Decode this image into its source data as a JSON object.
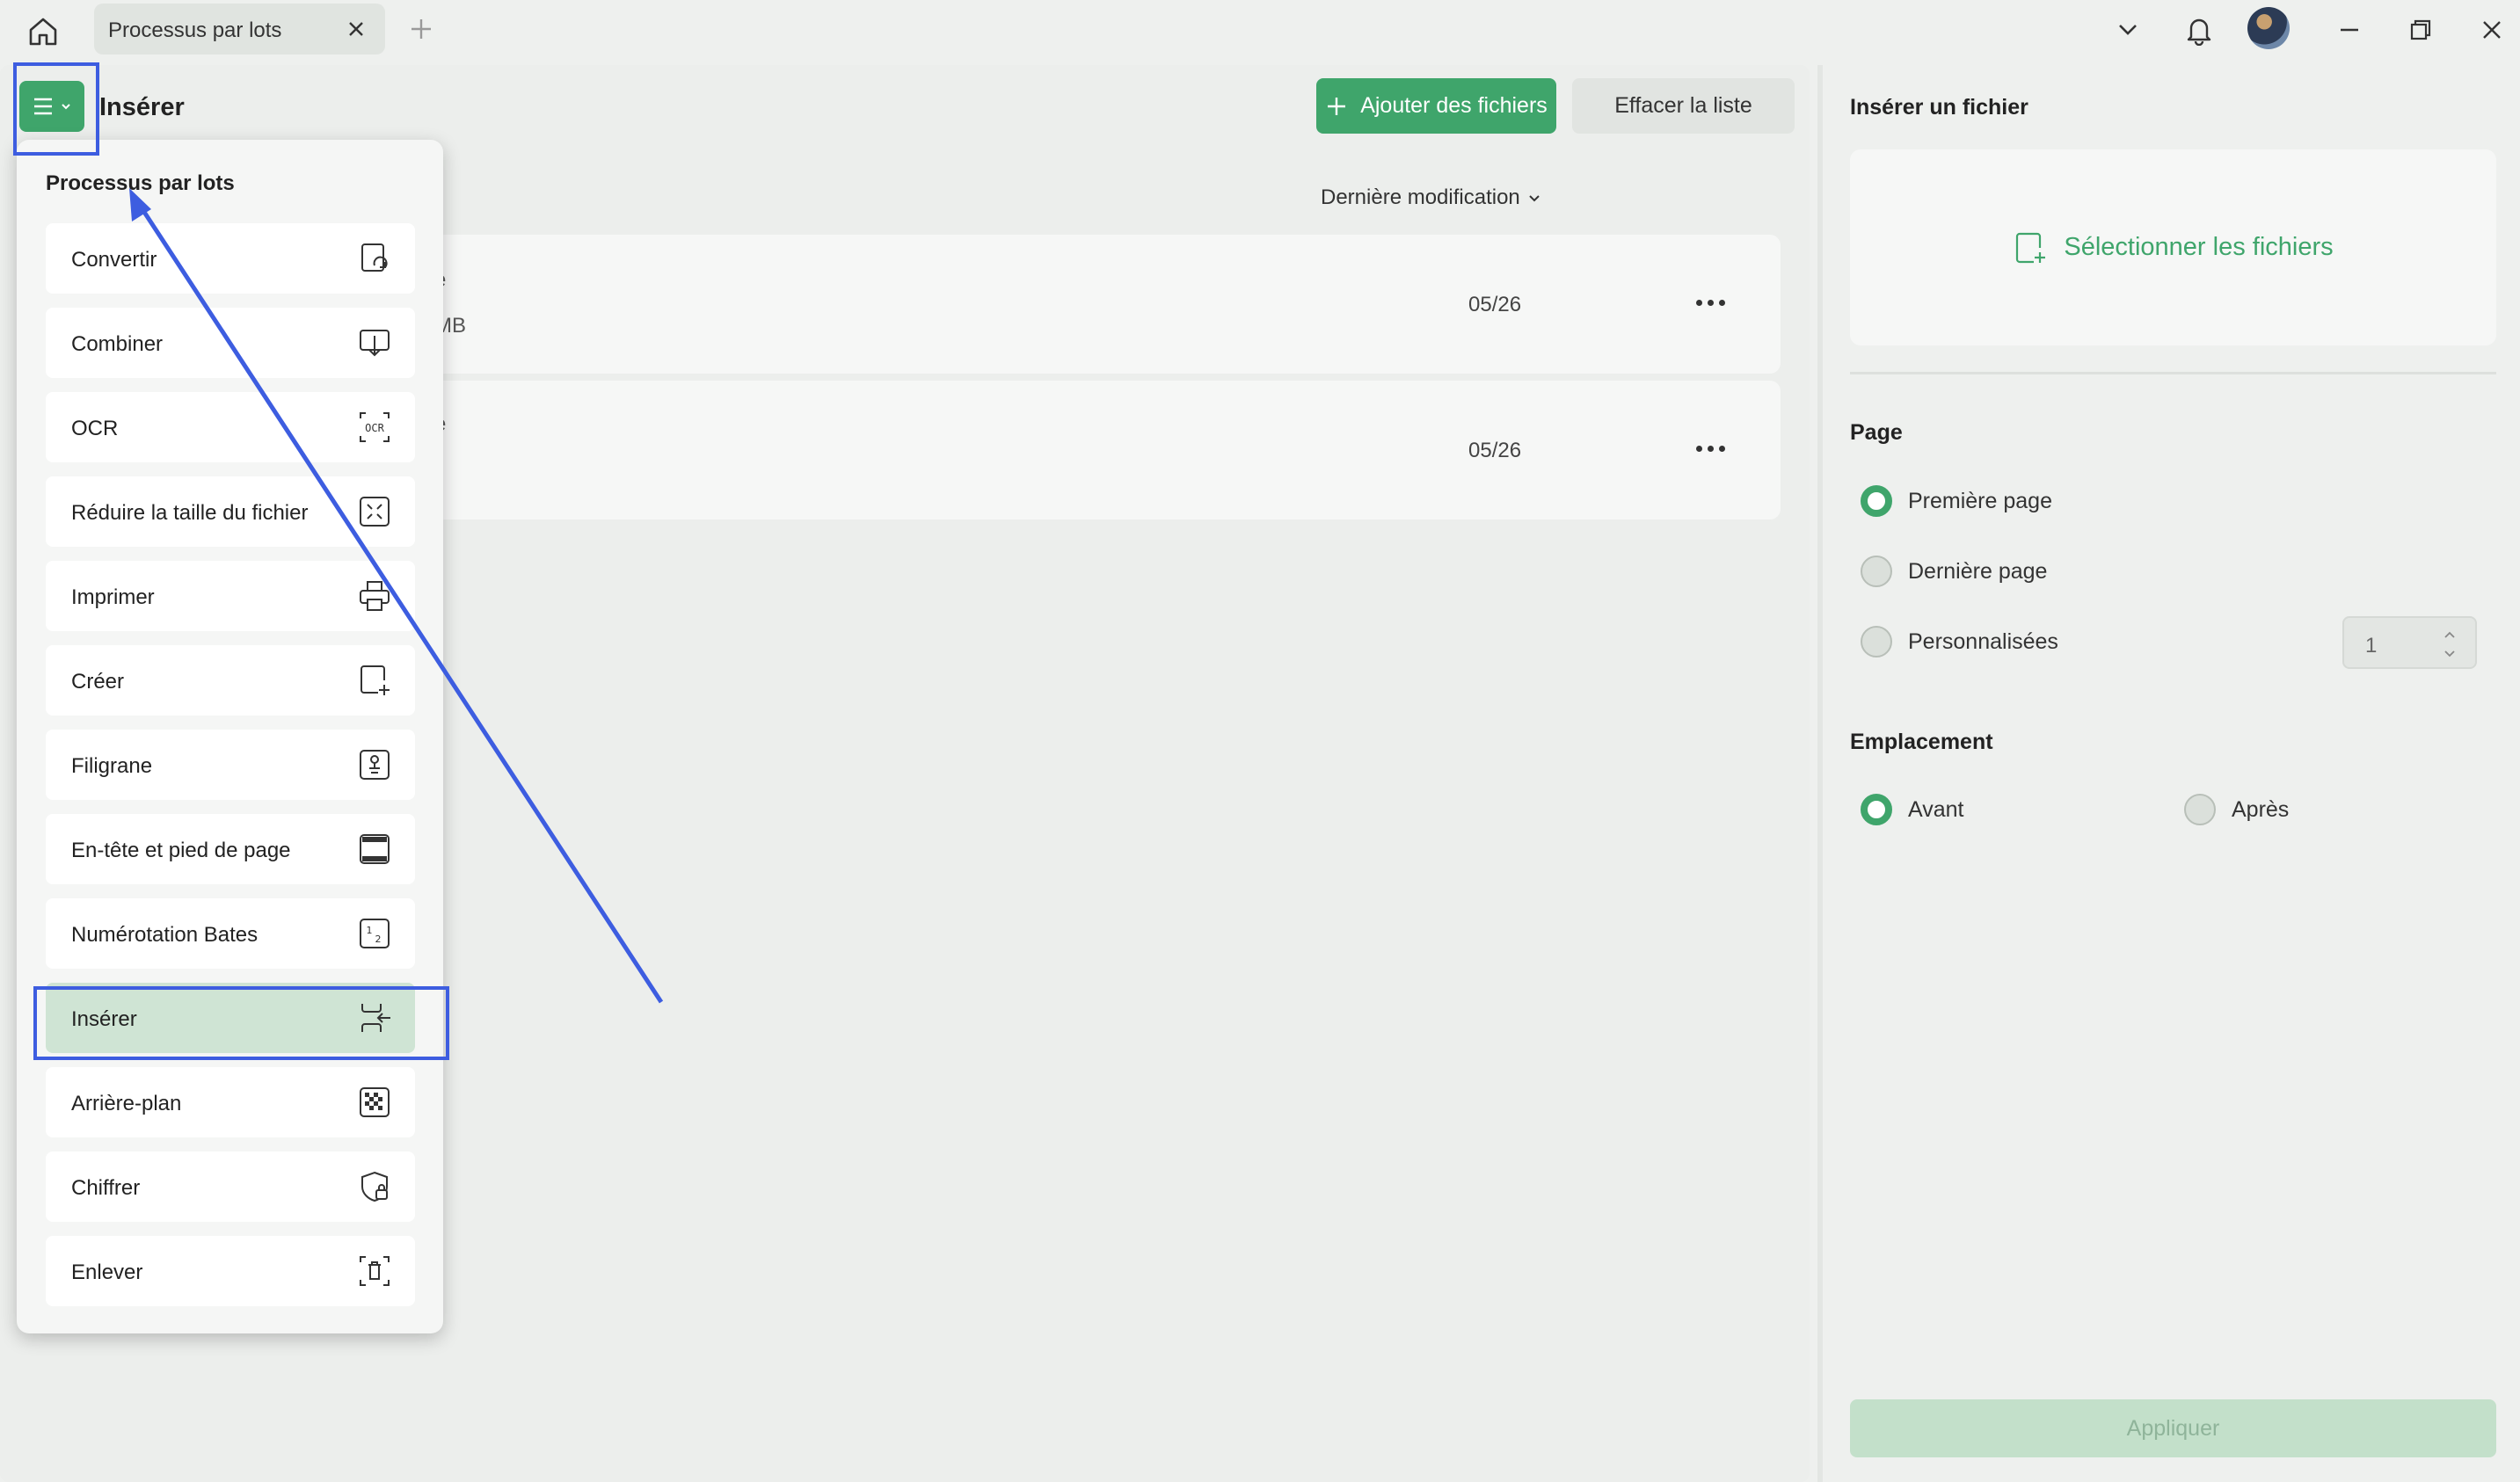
{
  "titlebar": {
    "tab_label": "Processus par lots",
    "icons": [
      "home-icon",
      "close-icon",
      "plus-icon",
      "chevron-down-icon",
      "bell-icon",
      "avatar",
      "minimize-icon",
      "restore-icon",
      "close-icon"
    ]
  },
  "main": {
    "title": "Insérer",
    "add_files_label": "Ajouter des fichiers",
    "clear_list_label": "Effacer la liste",
    "sort_label": "Dernière modification",
    "files": [
      {
        "name_fragment": "e",
        "size_fragment": "MB",
        "date": "05/26"
      },
      {
        "name_fragment": "e",
        "size_fragment": "",
        "date": "05/26"
      }
    ]
  },
  "dropdown": {
    "title": "Processus par lots",
    "items": [
      {
        "label": "Convertir",
        "icon": "convert-icon"
      },
      {
        "label": "Combiner",
        "icon": "combine-icon"
      },
      {
        "label": "OCR",
        "icon": "ocr-icon"
      },
      {
        "label": "Réduire la taille du fichier",
        "icon": "compress-icon"
      },
      {
        "label": "Imprimer",
        "icon": "printer-icon"
      },
      {
        "label": "Créer",
        "icon": "create-icon"
      },
      {
        "label": "Filigrane",
        "icon": "watermark-icon"
      },
      {
        "label": "En-tête et pied de page",
        "icon": "header-footer-icon"
      },
      {
        "label": "Numérotation Bates",
        "icon": "bates-icon"
      },
      {
        "label": "Insérer",
        "icon": "insert-icon",
        "active": true
      },
      {
        "label": "Arrière-plan",
        "icon": "background-icon"
      },
      {
        "label": "Chiffrer",
        "icon": "encrypt-icon"
      },
      {
        "label": "Enlever",
        "icon": "remove-icon"
      }
    ]
  },
  "panel": {
    "title": "Insérer un fichier",
    "select_files_label": "Sélectionner les fichiers",
    "page_section": "Page",
    "page_options": {
      "first": "Première page",
      "last": "Dernière page",
      "custom": "Personnalisées"
    },
    "page_selected": "Première page",
    "custom_page_value": "1",
    "location_section": "Emplacement",
    "location_options": {
      "before": "Avant",
      "after": "Après"
    },
    "location_selected": "Avant",
    "apply_label": "Appliquer"
  },
  "colors": {
    "accent": "#3fa56b",
    "highlight": "#3d5de0",
    "active_item": "#cfe4d4"
  }
}
